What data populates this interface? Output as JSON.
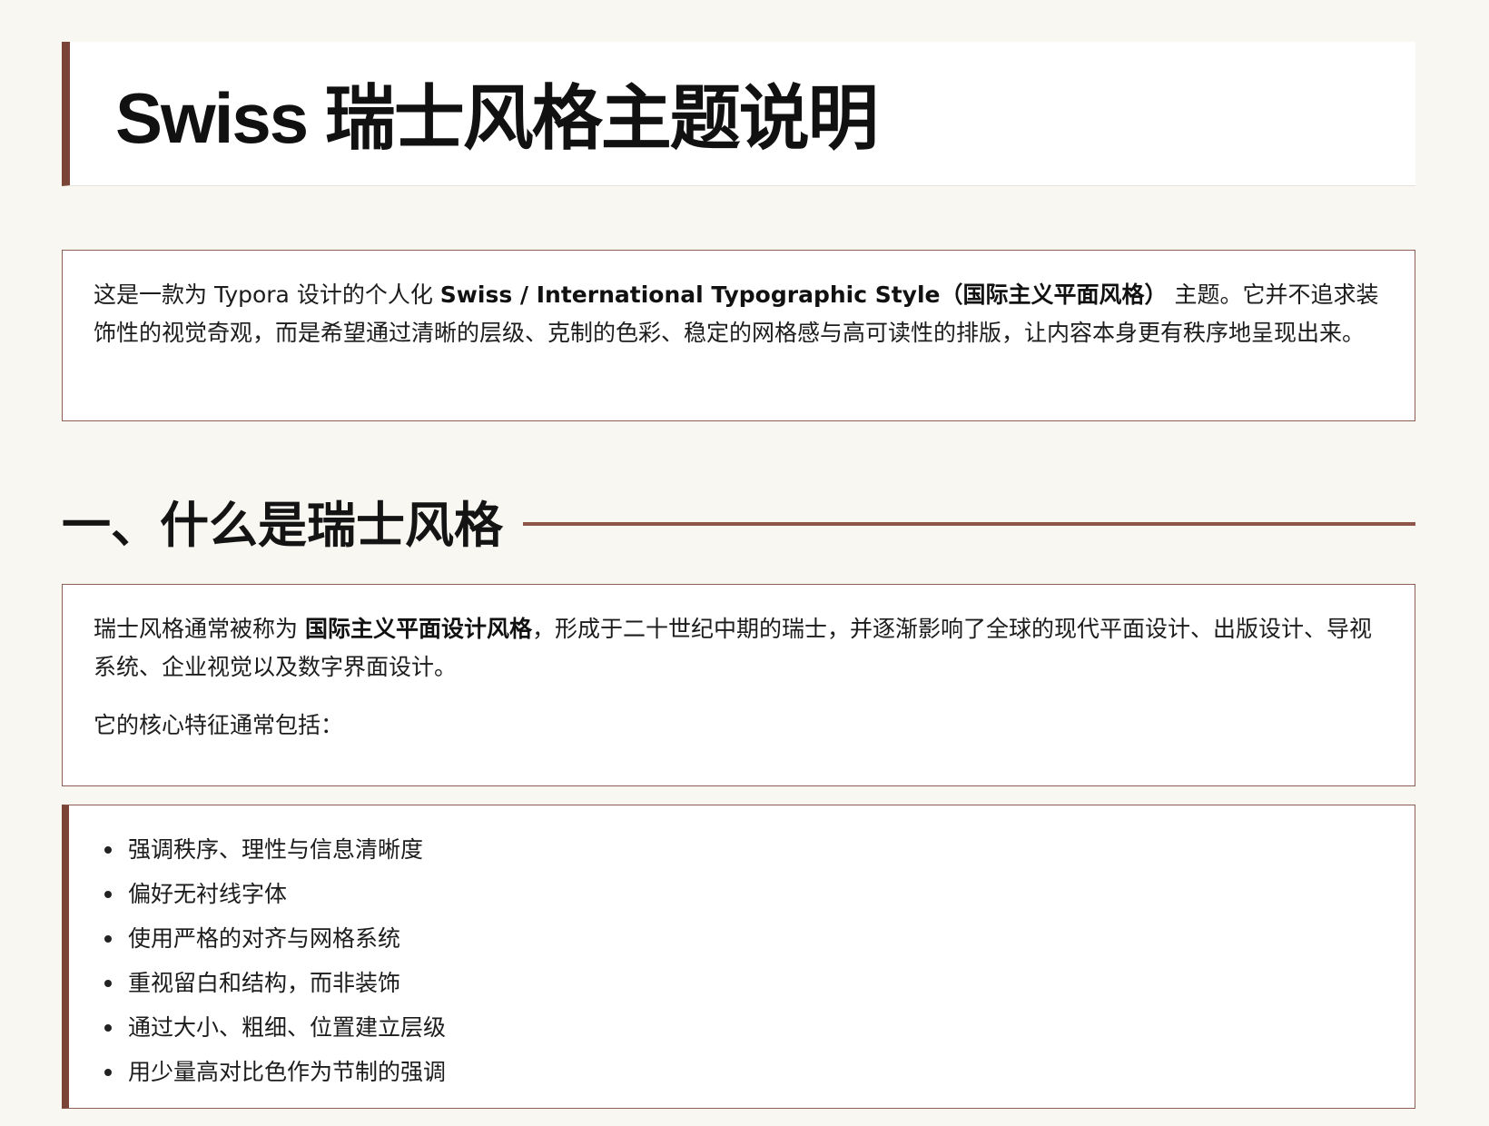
{
  "title": "Swiss 瑞士风格主题说明",
  "intro": {
    "pre": "这是一款为 Typora 设计的个人化 ",
    "strong": "Swiss / International Typographic Style（国际主义平面风格）",
    "post": " 主题。它并不追求装饰性的视觉奇观，而是希望通过清晰的层级、克制的色彩、稳定的网格感与高可读性的排版，让内容本身更有秩序地呈现出来。"
  },
  "section1": {
    "heading": "一、什么是瑞士风格",
    "para1_pre": "瑞士风格通常被称为 ",
    "para1_strong": "国际主义平面设计风格",
    "para1_post": "，形成于二十世纪中期的瑞士，并逐渐影响了全球的现代平面设计、出版设计、导视系统、企业视觉以及数字界面设计。",
    "para2": "它的核心特征通常包括：",
    "features": [
      "强调秩序、理性与信息清晰度",
      "偏好无衬线字体",
      "使用严格的对齐与网格系统",
      "重视留白和结构，而非装饰",
      "通过大小、粗细、位置建立层级",
      "用少量高对比色作为节制的强调"
    ]
  },
  "colors": {
    "background": "#f9f7f2",
    "accent": "#7a4437",
    "border": "#8e5e52",
    "text": "#1a1a1a"
  }
}
